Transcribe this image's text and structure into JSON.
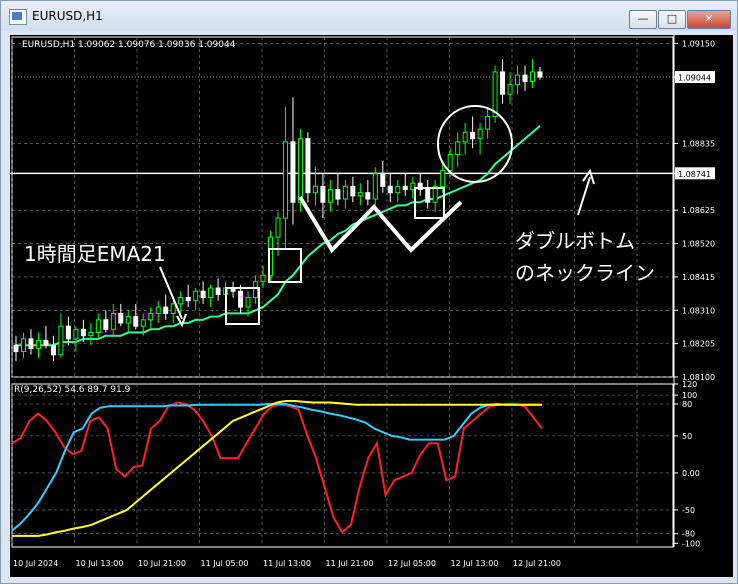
{
  "window": {
    "title": "EURUSD,H1",
    "min_glyph": "—",
    "max_glyph": "□",
    "close_glyph": "✕"
  },
  "chart_data": [
    {
      "type": "candlestick",
      "symbol_info": "EURUSD,H1  1.09062 1.09076 1.09036 1.09044",
      "ylim": [
        1.081,
        1.0917
      ],
      "y_ticks": [
        "1.09150",
        "1.09044",
        "1.08835",
        "1.08741",
        "1.08625",
        "1.08520",
        "1.08415",
        "1.08310",
        "1.08205",
        "1.08100"
      ],
      "current_price": "1.09044",
      "neckline_price": "1.08741",
      "neckline_color": "#ffffff",
      "bull_color": "#00ff00",
      "bear_color": "#ffffff",
      "ema_color": "#33ff99",
      "candles": [
        [
          1.082,
          1.0823,
          1.0815,
          1.0818
        ],
        [
          1.0818,
          1.0824,
          1.0816,
          1.0822
        ],
        [
          1.0822,
          1.0825,
          1.0817,
          1.0819
        ],
        [
          1.0819,
          1.0824,
          1.0816,
          1.08215
        ],
        [
          1.08215,
          1.0826,
          1.0819,
          1.082
        ],
        [
          1.082,
          1.0823,
          1.0815,
          1.0817
        ],
        [
          1.0817,
          1.083,
          1.0816,
          1.0826
        ],
        [
          1.0826,
          1.0829,
          1.082,
          1.0822
        ],
        [
          1.0822,
          1.0826,
          1.0818,
          1.0825
        ],
        [
          1.0825,
          1.0828,
          1.0821,
          1.0823
        ],
        [
          1.0823,
          1.0827,
          1.082,
          1.0824
        ],
        [
          1.0824,
          1.083,
          1.0822,
          1.0828
        ],
        [
          1.0828,
          1.0831,
          1.0824,
          1.0825
        ],
        [
          1.0825,
          1.0833,
          1.0823,
          1.083
        ],
        [
          1.083,
          1.0833,
          1.0826,
          1.0827
        ],
        [
          1.0827,
          1.0831,
          1.0824,
          1.0829
        ],
        [
          1.0829,
          1.0833,
          1.0825,
          1.0826
        ],
        [
          1.0826,
          1.083,
          1.0823,
          1.0828
        ],
        [
          1.0828,
          1.0832,
          1.0825,
          1.083
        ],
        [
          1.083,
          1.0834,
          1.0827,
          1.0832
        ],
        [
          1.0832,
          1.0836,
          1.0828,
          1.083
        ],
        [
          1.083,
          1.0834,
          1.0827,
          1.0833
        ],
        [
          1.0833,
          1.0837,
          1.083,
          1.0835
        ],
        [
          1.0835,
          1.0839,
          1.0832,
          1.0834
        ],
        [
          1.0834,
          1.0838,
          1.0831,
          1.0837
        ],
        [
          1.0837,
          1.084,
          1.0833,
          1.0835
        ],
        [
          1.0835,
          1.0839,
          1.0832,
          1.0838
        ],
        [
          1.0838,
          1.0841,
          1.0834,
          1.0836
        ],
        [
          1.0836,
          1.084,
          1.0833,
          1.0838
        ],
        [
          1.0838,
          1.084,
          1.0835,
          1.0837
        ],
        [
          1.0837,
          1.0839,
          1.083,
          1.0832
        ],
        [
          1.0832,
          1.0837,
          1.0829,
          1.0835
        ],
        [
          1.0835,
          1.0842,
          1.0833,
          1.084
        ],
        [
          1.084,
          1.0845,
          1.0838,
          1.0842
        ],
        [
          1.0842,
          1.0856,
          1.084,
          1.0854
        ],
        [
          1.0854,
          1.0862,
          1.0848,
          1.086
        ],
        [
          1.086,
          1.0895,
          1.085,
          1.0884
        ],
        [
          1.0884,
          1.0898,
          1.0858,
          1.0865
        ],
        [
          1.0865,
          1.0888,
          1.0862,
          1.0885
        ],
        [
          1.0885,
          1.0887,
          1.0865,
          1.0868
        ],
        [
          1.0868,
          1.0876,
          1.0864,
          1.087
        ],
        [
          1.087,
          1.0874,
          1.086,
          1.0865
        ],
        [
          1.0865,
          1.0872,
          1.0862,
          1.0869
        ],
        [
          1.0869,
          1.0874,
          1.0864,
          1.0866
        ],
        [
          1.0866,
          1.0872,
          1.0863,
          1.087
        ],
        [
          1.087,
          1.0873,
          1.0865,
          1.0867
        ],
        [
          1.0867,
          1.0871,
          1.0864,
          1.0868
        ],
        [
          1.0868,
          1.0872,
          1.0864,
          1.0866
        ],
        [
          1.0866,
          1.0876,
          1.0864,
          1.0874
        ],
        [
          1.0874,
          1.0878,
          1.0868,
          1.087
        ],
        [
          1.087,
          1.0874,
          1.0865,
          1.0868
        ],
        [
          1.0868,
          1.0872,
          1.0865,
          1.087
        ],
        [
          1.087,
          1.0874,
          1.0867,
          1.0869
        ],
        [
          1.0869,
          1.0873,
          1.0866,
          1.0871
        ],
        [
          1.0871,
          1.0874,
          1.0867,
          1.0869
        ],
        [
          1.0869,
          1.0872,
          1.0863,
          1.0865
        ],
        [
          1.0865,
          1.0872,
          1.0862,
          1.087
        ],
        [
          1.087,
          1.0878,
          1.0868,
          1.0875
        ],
        [
          1.0875,
          1.0882,
          1.0873,
          1.088
        ],
        [
          1.088,
          1.0887,
          1.0876,
          1.0884
        ],
        [
          1.0884,
          1.089,
          1.088,
          1.0887
        ],
        [
          1.0887,
          1.0892,
          1.0882,
          1.0885
        ],
        [
          1.0885,
          1.089,
          1.088,
          1.0888
        ],
        [
          1.0888,
          1.0895,
          1.0885,
          1.0892
        ],
        [
          1.0892,
          1.0908,
          1.089,
          1.0906
        ],
        [
          1.0906,
          1.091,
          1.0896,
          1.0899
        ],
        [
          1.0899,
          1.0906,
          1.0896,
          1.0902
        ],
        [
          1.0902,
          1.0908,
          1.0899,
          1.0905
        ],
        [
          1.0905,
          1.0908,
          1.09,
          1.0903
        ],
        [
          1.0903,
          1.091,
          1.0901,
          1.0906
        ],
        [
          1.0906,
          1.09076,
          1.09036,
          1.09044
        ]
      ],
      "ema": [
        1.082,
        1.082,
        1.082,
        1.082,
        1.082,
        1.082,
        1.0821,
        1.0821,
        1.0821,
        1.0822,
        1.0822,
        1.0822,
        1.0823,
        1.0823,
        1.0823,
        1.0824,
        1.0824,
        1.0824,
        1.0825,
        1.0825,
        1.0826,
        1.0826,
        1.0827,
        1.0827,
        1.0828,
        1.0828,
        1.0829,
        1.0829,
        1.083,
        1.083,
        1.083,
        1.083,
        1.0831,
        1.0832,
        1.0834,
        1.0836,
        1.084,
        1.0842,
        1.0845,
        1.0848,
        1.085,
        1.0852,
        1.0853,
        1.0855,
        1.0856,
        1.0858,
        1.0859,
        1.086,
        1.0861,
        1.0862,
        1.0863,
        1.0864,
        1.0864,
        1.0865,
        1.0865,
        1.0866,
        1.0866,
        1.0867,
        1.0868,
        1.0869,
        1.087,
        1.0871,
        1.0872,
        1.0874,
        1.0877,
        1.0879,
        1.0881,
        1.0883,
        1.0885,
        1.0887,
        1.0889
      ]
    },
    {
      "type": "line",
      "label": "R(9,26,52) 54.6 89.7 91.9",
      "ylim": [
        -100,
        120
      ],
      "y_ticks": [
        {
          "label": "120",
          "v": 120
        },
        {
          "label": "100",
          "v": 105
        },
        {
          "label": "80",
          "v": 93
        },
        {
          "label": "50",
          "v": 50
        },
        {
          "label": "0.00",
          "v": 0
        },
        {
          "label": "-50",
          "v": -50
        },
        {
          "label": "-80",
          "v": -82
        },
        {
          "label": "-100",
          "v": -95
        }
      ],
      "series": [
        {
          "color": "#ff2020",
          "values": [
            40,
            47,
            70,
            80,
            70,
            55,
            35,
            25,
            30,
            70,
            75,
            60,
            5,
            -5,
            8,
            10,
            60,
            70,
            90,
            95,
            93,
            85,
            70,
            50,
            20,
            20,
            20,
            40,
            60,
            80,
            90,
            92,
            90,
            85,
            50,
            20,
            -20,
            -60,
            -80,
            -70,
            -20,
            20,
            40,
            -30,
            -10,
            -5,
            0,
            25,
            40,
            40,
            -10,
            -5,
            60,
            70,
            80,
            90,
            92,
            93,
            93,
            90,
            75,
            60
          ]
        },
        {
          "color": "#33ccff",
          "values": [
            -78,
            -68,
            -55,
            -40,
            -20,
            0,
            30,
            55,
            60,
            80,
            88,
            90,
            90,
            90,
            90,
            90,
            90,
            90,
            91,
            91,
            91,
            92,
            92,
            92,
            92,
            92,
            92,
            92,
            92,
            93,
            93,
            93,
            90,
            88,
            85,
            83,
            80,
            78,
            75,
            72,
            68,
            60,
            55,
            50,
            48,
            45,
            45,
            45,
            45,
            45,
            50,
            65,
            80,
            88,
            92,
            93,
            92,
            92,
            92,
            92,
            92
          ]
        },
        {
          "color": "#ffff33",
          "values": [
            -85,
            -85,
            -85,
            -85,
            -83,
            -80,
            -78,
            -75,
            -73,
            -70,
            -65,
            -60,
            -55,
            -50,
            -40,
            -30,
            -20,
            -10,
            0,
            10,
            20,
            30,
            40,
            50,
            60,
            70,
            75,
            80,
            85,
            90,
            95,
            97,
            97,
            96,
            95,
            95,
            95,
            94,
            93,
            92,
            92,
            92,
            92,
            92,
            92,
            92,
            92,
            92,
            92,
            92,
            92,
            92,
            92,
            92,
            92,
            92,
            92,
            92,
            92,
            92,
            92
          ]
        }
      ]
    }
  ],
  "x_labels": [
    "10 Jul 2024",
    "10 Jul 13:00",
    "10 Jul 21:00",
    "11 Jul 05:00",
    "11 Jul 13:00",
    "11 Jul 21:00",
    "12 Jul 05:00",
    "12 Jul 13:00",
    "12 Jul 21:00"
  ],
  "annotations": {
    "ema_label": "1時間足EMA21",
    "neckline_label_line1": "ダブルボトム",
    "neckline_label_line2": "のネックライン"
  }
}
